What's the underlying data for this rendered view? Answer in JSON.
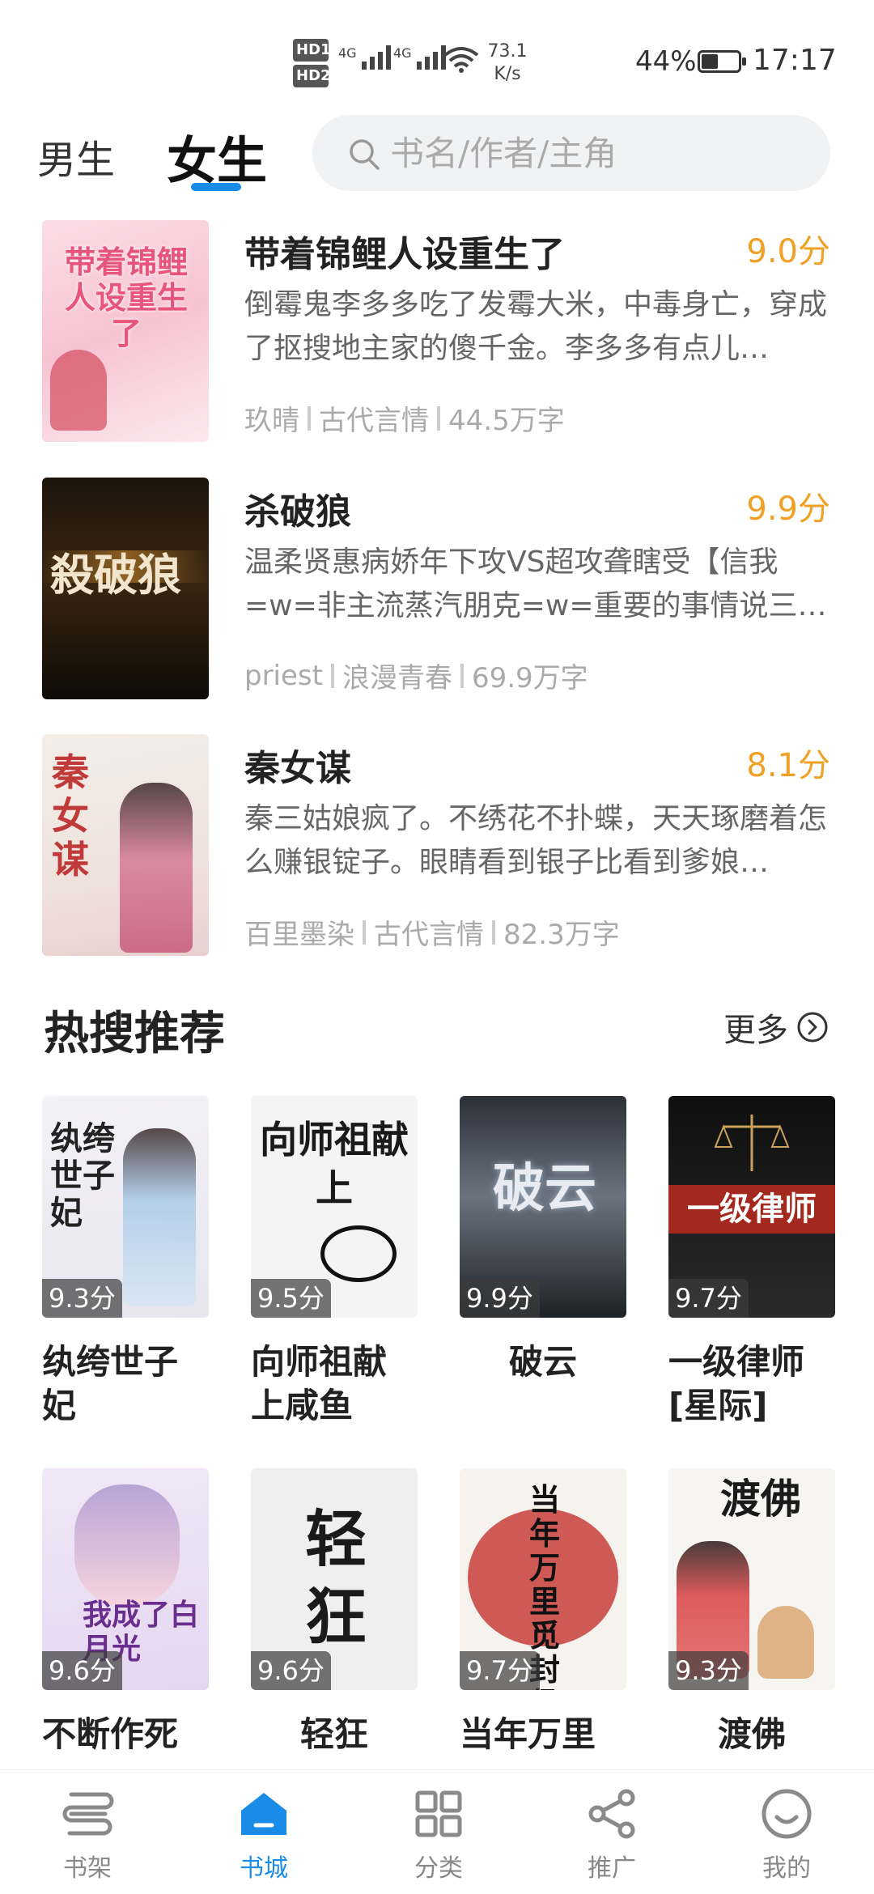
{
  "status_bar": {
    "hd1": "HD1",
    "hd2": "HD2",
    "network1": "4G",
    "network2": "4G",
    "speed_value": "73.1",
    "speed_unit": "K/s",
    "battery": "44%",
    "battery_level": 0.44,
    "time": "17:17"
  },
  "header": {
    "tab_male": "男生",
    "tab_female": "女生",
    "search_placeholder": "书名/作者/主角"
  },
  "books": [
    {
      "title": "带着锦鲤人设重生了",
      "score": "9.0分",
      "desc": "倒霉鬼李多多吃了发霉大米，中毒身亡，穿成了抠搜地主家的傻千金。李多多有点儿…",
      "author": "玖晴",
      "category": "古代言情",
      "words": "44.5万字",
      "cover_text": "带着锦鲤人设重生了"
    },
    {
      "title": "杀破狼",
      "score": "9.9分",
      "desc": "温柔贤惠病娇年下攻VS超攻聋瞎受【信我=w=非主流蒸汽朋克=w=重要的事情说三…",
      "author": "priest",
      "category": "浪漫青春",
      "words": "69.9万字",
      "cover_text": "殺破狼"
    },
    {
      "title": "秦女谋",
      "score": "8.1分",
      "desc": "秦三姑娘疯了。不绣花不扑蝶，天天琢磨着怎么赚银锭子。眼睛看到银子比看到爹娘…",
      "author": "百里墨染",
      "category": "古代言情",
      "words": "82.3万字",
      "cover_text": "秦女谋"
    }
  ],
  "hot": {
    "title": "热搜推荐",
    "more": "更多",
    "items": [
      {
        "name": "纨绔世子妃",
        "score": "9.3分",
        "cover_text": "纨绔世子妃"
      },
      {
        "name": "向师祖献上咸鱼",
        "score": "9.5分",
        "cover_text": "向师祖献上"
      },
      {
        "name": "破云",
        "score": "9.9分",
        "cover_text": "破云"
      },
      {
        "name": "一级律师[星际]",
        "score": "9.7分",
        "cover_text": "一级律师"
      },
      {
        "name": "不断作死",
        "score": "9.6分",
        "cover_text": "我成了白月光"
      },
      {
        "name": "轻狂",
        "score": "9.6分",
        "cover_text": "轻狂"
      },
      {
        "name": "当年万里",
        "score": "9.7分",
        "cover_text": "当年万里觅封侯"
      },
      {
        "name": "渡佛",
        "score": "9.3分",
        "cover_text": "渡佛"
      }
    ]
  },
  "nav": {
    "items": [
      {
        "label": "书架",
        "icon": "bookshelf-icon"
      },
      {
        "label": "书城",
        "icon": "bookstore-icon"
      },
      {
        "label": "分类",
        "icon": "category-icon"
      },
      {
        "label": "推广",
        "icon": "share-icon"
      },
      {
        "label": "我的",
        "icon": "profile-icon"
      }
    ],
    "active": 1
  },
  "colors": {
    "accent": "#1a8ce8",
    "score": "#f0a024"
  }
}
